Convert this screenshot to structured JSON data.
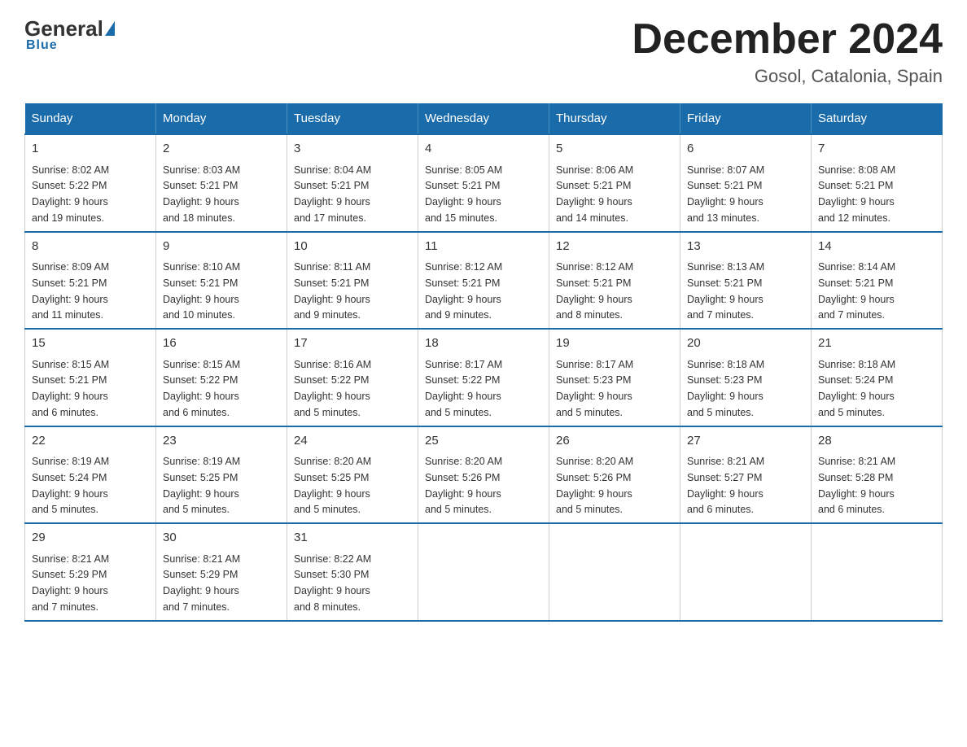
{
  "header": {
    "logo": {
      "general": "General",
      "blue": "Blue",
      "underline": "Blue"
    },
    "title": "December 2024",
    "location": "Gosol, Catalonia, Spain"
  },
  "days_of_week": [
    "Sunday",
    "Monday",
    "Tuesday",
    "Wednesday",
    "Thursday",
    "Friday",
    "Saturday"
  ],
  "weeks": [
    [
      {
        "day": "1",
        "sunrise": "8:02 AM",
        "sunset": "5:22 PM",
        "daylight": "9 hours and 19 minutes."
      },
      {
        "day": "2",
        "sunrise": "8:03 AM",
        "sunset": "5:21 PM",
        "daylight": "9 hours and 18 minutes."
      },
      {
        "day": "3",
        "sunrise": "8:04 AM",
        "sunset": "5:21 PM",
        "daylight": "9 hours and 17 minutes."
      },
      {
        "day": "4",
        "sunrise": "8:05 AM",
        "sunset": "5:21 PM",
        "daylight": "9 hours and 15 minutes."
      },
      {
        "day": "5",
        "sunrise": "8:06 AM",
        "sunset": "5:21 PM",
        "daylight": "9 hours and 14 minutes."
      },
      {
        "day": "6",
        "sunrise": "8:07 AM",
        "sunset": "5:21 PM",
        "daylight": "9 hours and 13 minutes."
      },
      {
        "day": "7",
        "sunrise": "8:08 AM",
        "sunset": "5:21 PM",
        "daylight": "9 hours and 12 minutes."
      }
    ],
    [
      {
        "day": "8",
        "sunrise": "8:09 AM",
        "sunset": "5:21 PM",
        "daylight": "9 hours and 11 minutes."
      },
      {
        "day": "9",
        "sunrise": "8:10 AM",
        "sunset": "5:21 PM",
        "daylight": "9 hours and 10 minutes."
      },
      {
        "day": "10",
        "sunrise": "8:11 AM",
        "sunset": "5:21 PM",
        "daylight": "9 hours and 9 minutes."
      },
      {
        "day": "11",
        "sunrise": "8:12 AM",
        "sunset": "5:21 PM",
        "daylight": "9 hours and 9 minutes."
      },
      {
        "day": "12",
        "sunrise": "8:12 AM",
        "sunset": "5:21 PM",
        "daylight": "9 hours and 8 minutes."
      },
      {
        "day": "13",
        "sunrise": "8:13 AM",
        "sunset": "5:21 PM",
        "daylight": "9 hours and 7 minutes."
      },
      {
        "day": "14",
        "sunrise": "8:14 AM",
        "sunset": "5:21 PM",
        "daylight": "9 hours and 7 minutes."
      }
    ],
    [
      {
        "day": "15",
        "sunrise": "8:15 AM",
        "sunset": "5:21 PM",
        "daylight": "9 hours and 6 minutes."
      },
      {
        "day": "16",
        "sunrise": "8:15 AM",
        "sunset": "5:22 PM",
        "daylight": "9 hours and 6 minutes."
      },
      {
        "day": "17",
        "sunrise": "8:16 AM",
        "sunset": "5:22 PM",
        "daylight": "9 hours and 5 minutes."
      },
      {
        "day": "18",
        "sunrise": "8:17 AM",
        "sunset": "5:22 PM",
        "daylight": "9 hours and 5 minutes."
      },
      {
        "day": "19",
        "sunrise": "8:17 AM",
        "sunset": "5:23 PM",
        "daylight": "9 hours and 5 minutes."
      },
      {
        "day": "20",
        "sunrise": "8:18 AM",
        "sunset": "5:23 PM",
        "daylight": "9 hours and 5 minutes."
      },
      {
        "day": "21",
        "sunrise": "8:18 AM",
        "sunset": "5:24 PM",
        "daylight": "9 hours and 5 minutes."
      }
    ],
    [
      {
        "day": "22",
        "sunrise": "8:19 AM",
        "sunset": "5:24 PM",
        "daylight": "9 hours and 5 minutes."
      },
      {
        "day": "23",
        "sunrise": "8:19 AM",
        "sunset": "5:25 PM",
        "daylight": "9 hours and 5 minutes."
      },
      {
        "day": "24",
        "sunrise": "8:20 AM",
        "sunset": "5:25 PM",
        "daylight": "9 hours and 5 minutes."
      },
      {
        "day": "25",
        "sunrise": "8:20 AM",
        "sunset": "5:26 PM",
        "daylight": "9 hours and 5 minutes."
      },
      {
        "day": "26",
        "sunrise": "8:20 AM",
        "sunset": "5:26 PM",
        "daylight": "9 hours and 5 minutes."
      },
      {
        "day": "27",
        "sunrise": "8:21 AM",
        "sunset": "5:27 PM",
        "daylight": "9 hours and 6 minutes."
      },
      {
        "day": "28",
        "sunrise": "8:21 AM",
        "sunset": "5:28 PM",
        "daylight": "9 hours and 6 minutes."
      }
    ],
    [
      {
        "day": "29",
        "sunrise": "8:21 AM",
        "sunset": "5:29 PM",
        "daylight": "9 hours and 7 minutes."
      },
      {
        "day": "30",
        "sunrise": "8:21 AM",
        "sunset": "5:29 PM",
        "daylight": "9 hours and 7 minutes."
      },
      {
        "day": "31",
        "sunrise": "8:22 AM",
        "sunset": "5:30 PM",
        "daylight": "9 hours and 8 minutes."
      },
      null,
      null,
      null,
      null
    ]
  ],
  "labels": {
    "sunrise": "Sunrise:",
    "sunset": "Sunset:",
    "daylight": "Daylight:"
  }
}
